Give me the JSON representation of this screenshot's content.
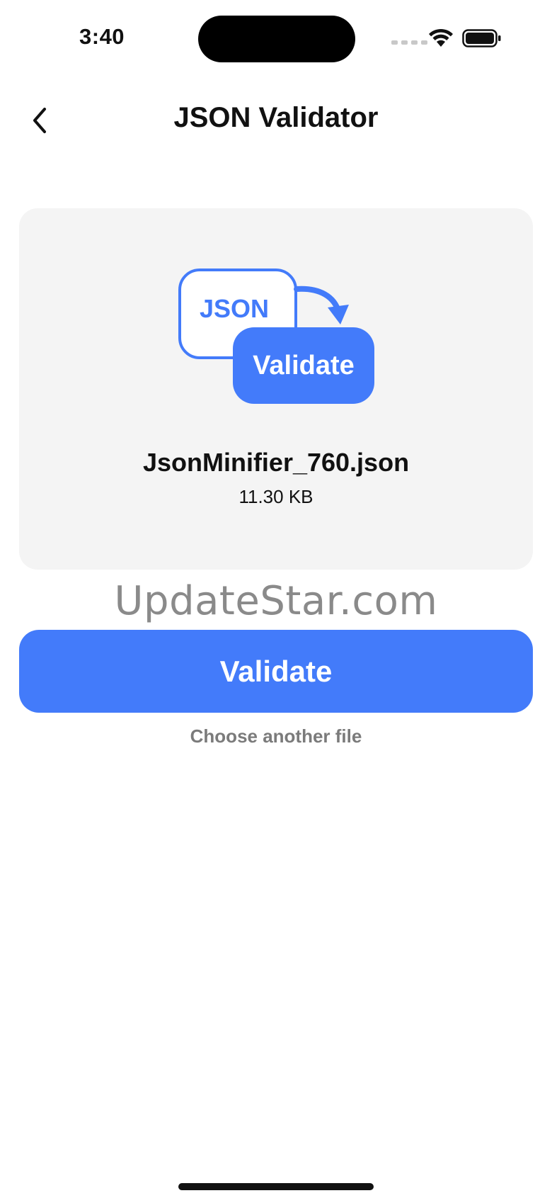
{
  "status_bar": {
    "time": "3:40",
    "icons": [
      "signal-dots",
      "wifi-icon",
      "battery-icon"
    ]
  },
  "header": {
    "back_icon": "chevron-left-icon",
    "title": "JSON Validator"
  },
  "file_card": {
    "illustration": {
      "icon": "json-validate-illustration",
      "back_tile_text": "JSON",
      "front_tile_text": "Validate",
      "accent_color": "#437bfa"
    },
    "file_name": "JsonMinifier_760.json",
    "file_size": "11.30 KB"
  },
  "watermark": "UpdateStar.com",
  "actions": {
    "validate_label": "Validate",
    "choose_another_label": "Choose another file"
  },
  "colors": {
    "primary": "#437bfa",
    "card_background": "#f4f4f4",
    "secondary_text": "#7b7b7b"
  }
}
